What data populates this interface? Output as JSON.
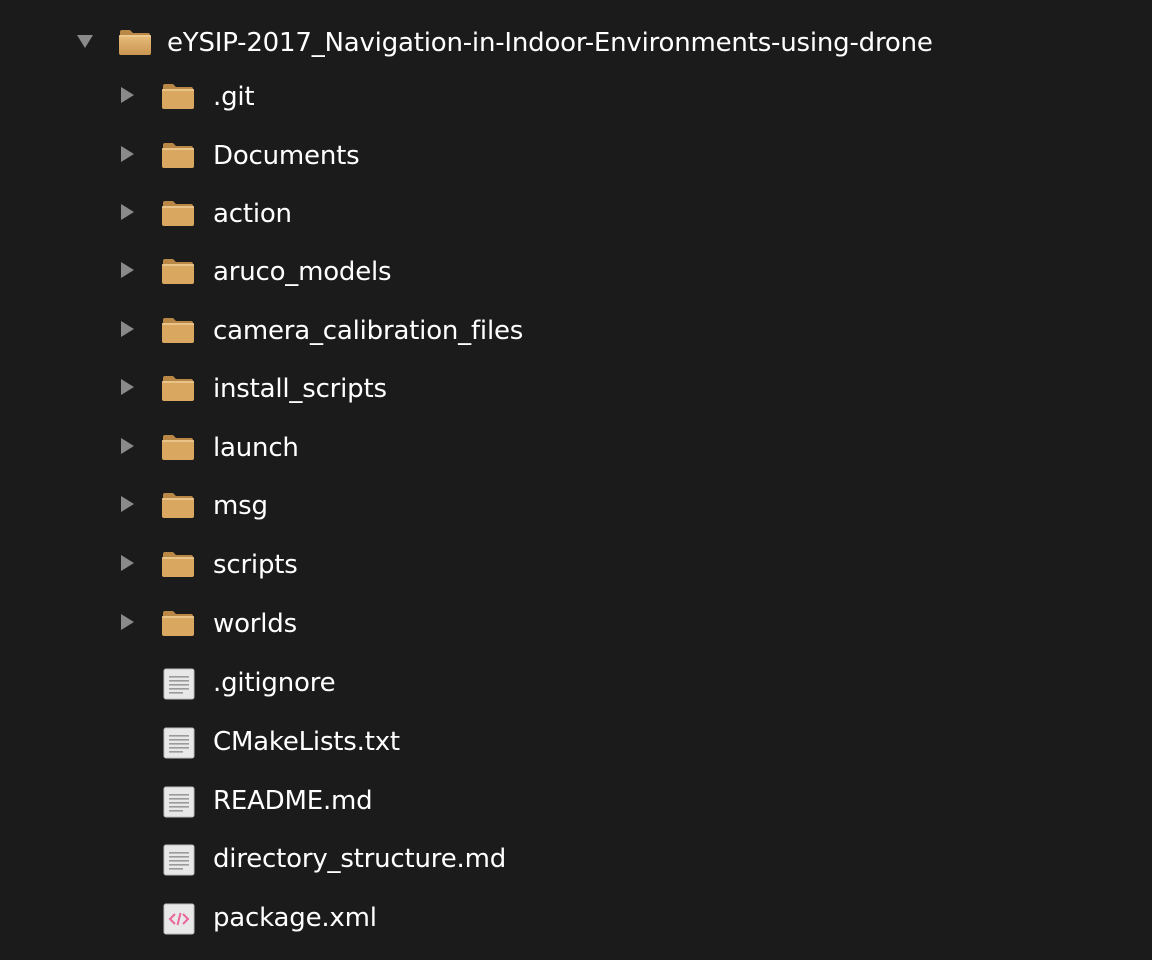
{
  "tree": {
    "root": {
      "name": "eYSIP-2017_Navigation-in-Indoor-Environments-using-drone",
      "expanded": true,
      "icon": "folder-icon"
    },
    "folders": [
      {
        "name": ".git"
      },
      {
        "name": "Documents"
      },
      {
        "name": "action"
      },
      {
        "name": "aruco_models"
      },
      {
        "name": "camera_calibration_files"
      },
      {
        "name": "install_scripts"
      },
      {
        "name": "launch"
      },
      {
        "name": "msg"
      },
      {
        "name": "scripts"
      },
      {
        "name": "worlds"
      }
    ],
    "files": [
      {
        "name": ".gitignore",
        "icon": "text-file-icon"
      },
      {
        "name": "CMakeLists.txt",
        "icon": "text-file-icon"
      },
      {
        "name": "README.md",
        "icon": "text-file-icon"
      },
      {
        "name": "directory_structure.md",
        "icon": "text-file-icon"
      },
      {
        "name": "package.xml",
        "icon": "code-file-icon"
      }
    ]
  },
  "colors": {
    "background": "#1b1b1b",
    "text": "#ffffff",
    "disclosure_arrow": "#8a8a8a",
    "folder": "#d9a760",
    "file": "#e8e8e8",
    "code_tag": "#e8669a"
  }
}
